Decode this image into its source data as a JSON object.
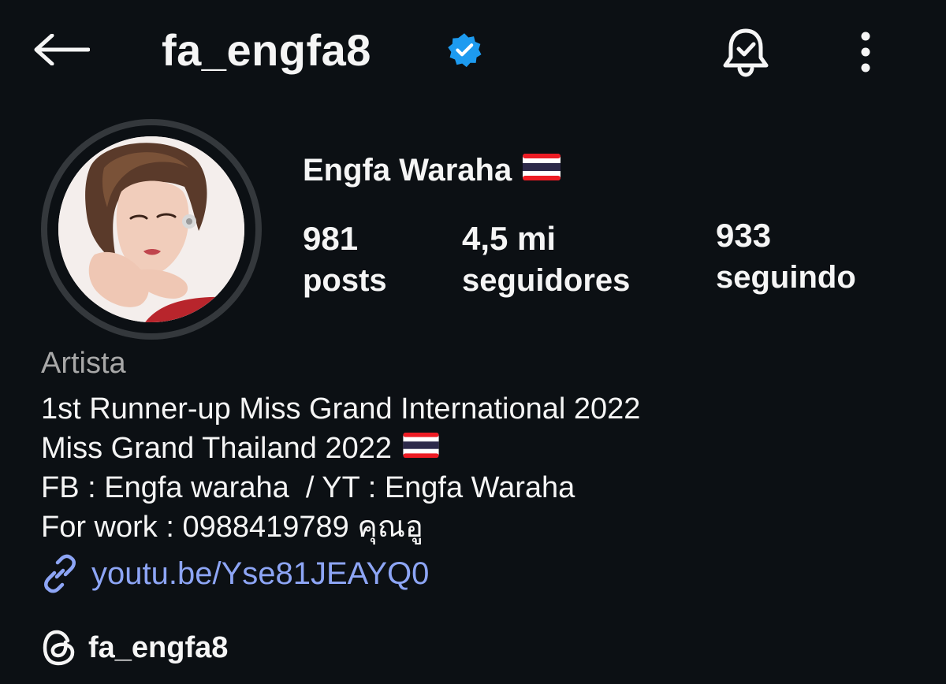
{
  "header": {
    "username": "fa_engfa8",
    "back_icon": "arrow-left-icon",
    "verified_icon": "verified-badge-icon",
    "notifications_icon": "bell-check-icon",
    "more_icon": "more-vertical-icon"
  },
  "profile": {
    "display_name": "Engfa Waraha",
    "flag_icon": "thailand-flag-icon",
    "avatar": "profile-photo"
  },
  "stats": {
    "posts": {
      "value": "981",
      "label": "posts"
    },
    "followers": {
      "value": "4,5 mi",
      "label": "seguidores"
    },
    "following": {
      "value": "933",
      "label": "seguindo"
    }
  },
  "bio": {
    "category": "Artista",
    "lines": [
      "1st Runner-up Miss Grand International 2022",
      "Miss Grand Thailand 2022",
      "FB : Engfa waraha  / YT : Engfa Waraha",
      "For work : 0988419789 คุณอู"
    ],
    "link_icon": "link-icon",
    "link": "youtu.be/Yse81JEAYQ0",
    "threads_icon": "threads-icon",
    "threads_handle": "fa_engfa8"
  },
  "colors": {
    "background": "#0c1014",
    "text": "#f5f5f5",
    "muted": "#a8a8a8",
    "link": "#8da5f5",
    "verified": "#1d9bf0",
    "avatar_ring": "#34383c",
    "flag_red": "#ed1c24",
    "flag_white": "#ffffff",
    "flag_blue": "#2d2a4a"
  }
}
